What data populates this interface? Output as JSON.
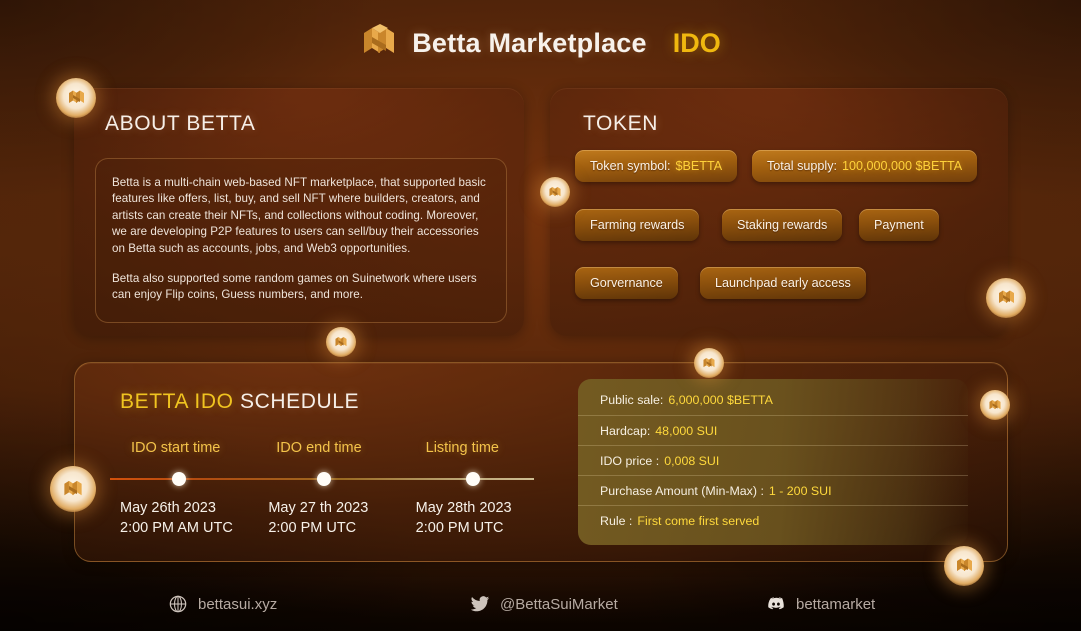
{
  "header": {
    "logo_icon": "betta-cube-logo-icon",
    "title": "Betta Marketplace",
    "ido_label": "IDO"
  },
  "about": {
    "heading": "ABOUT BETTA",
    "paragraph_1": "Betta is a multi-chain web-based NFT marketplace, that supported basic features like offers, list, buy, and sell NFT where builders, creators, and artists can create their NFTs, and collections without coding. Moreover, we are developing P2P features to users can sell/buy their accessories on Betta such as accounts, jobs, and Web3 opportunities.",
    "paragraph_2": "Betta also supported some random games on Suinetwork where users can enjoy Flip coins, Guess numbers, and more."
  },
  "token": {
    "heading": "TOKEN",
    "symbol_label": "Token symbol:",
    "symbol_value": "$BETTA",
    "supply_label": "Total supply:",
    "supply_value": "100,000,000 $BETTA",
    "utilities": [
      "Farming rewards",
      "Staking rewards",
      "Payment",
      "Gorvernance",
      "Launchpad early access"
    ]
  },
  "schedule": {
    "heading_gold": "BETTA IDO",
    "heading_white": "SCHEDULE",
    "milestones": [
      {
        "label": "IDO start time",
        "date": "May 26th 2023",
        "time": "2:00 PM AM UTC"
      },
      {
        "label": "IDO end time",
        "date": "May 27 th 2023",
        "time": "2:00 PM UTC"
      },
      {
        "label": "Listing time",
        "date": "May 28th 2023",
        "time": "2:00 PM UTC"
      }
    ]
  },
  "ido_info": {
    "rows": [
      {
        "label": "Public sale:",
        "value": "6,000,000 $BETTA"
      },
      {
        "label": "Hardcap:",
        "value": "48,000 SUI"
      },
      {
        "label": "IDO price :",
        "value": "0,008 SUI"
      },
      {
        "label": "Purchase Amount (Min-Max) :",
        "value": "1 - 200 SUI"
      },
      {
        "label": "Rule :",
        "value": "First come first served"
      }
    ]
  },
  "footer": {
    "website_icon": "globe-icon",
    "website": "bettasui.xyz",
    "twitter_icon": "twitter-bird-icon",
    "twitter": "@BettaSuiMarket",
    "discord_icon": "discord-icon",
    "discord": "bettamarket"
  },
  "colors": {
    "background": "#4a2209",
    "accent_gold": "#f0b80f",
    "value_gold": "#ffd23a",
    "pill": "#a2600f",
    "info_panel": "#6c551f",
    "text_light": "#f6efe8"
  }
}
